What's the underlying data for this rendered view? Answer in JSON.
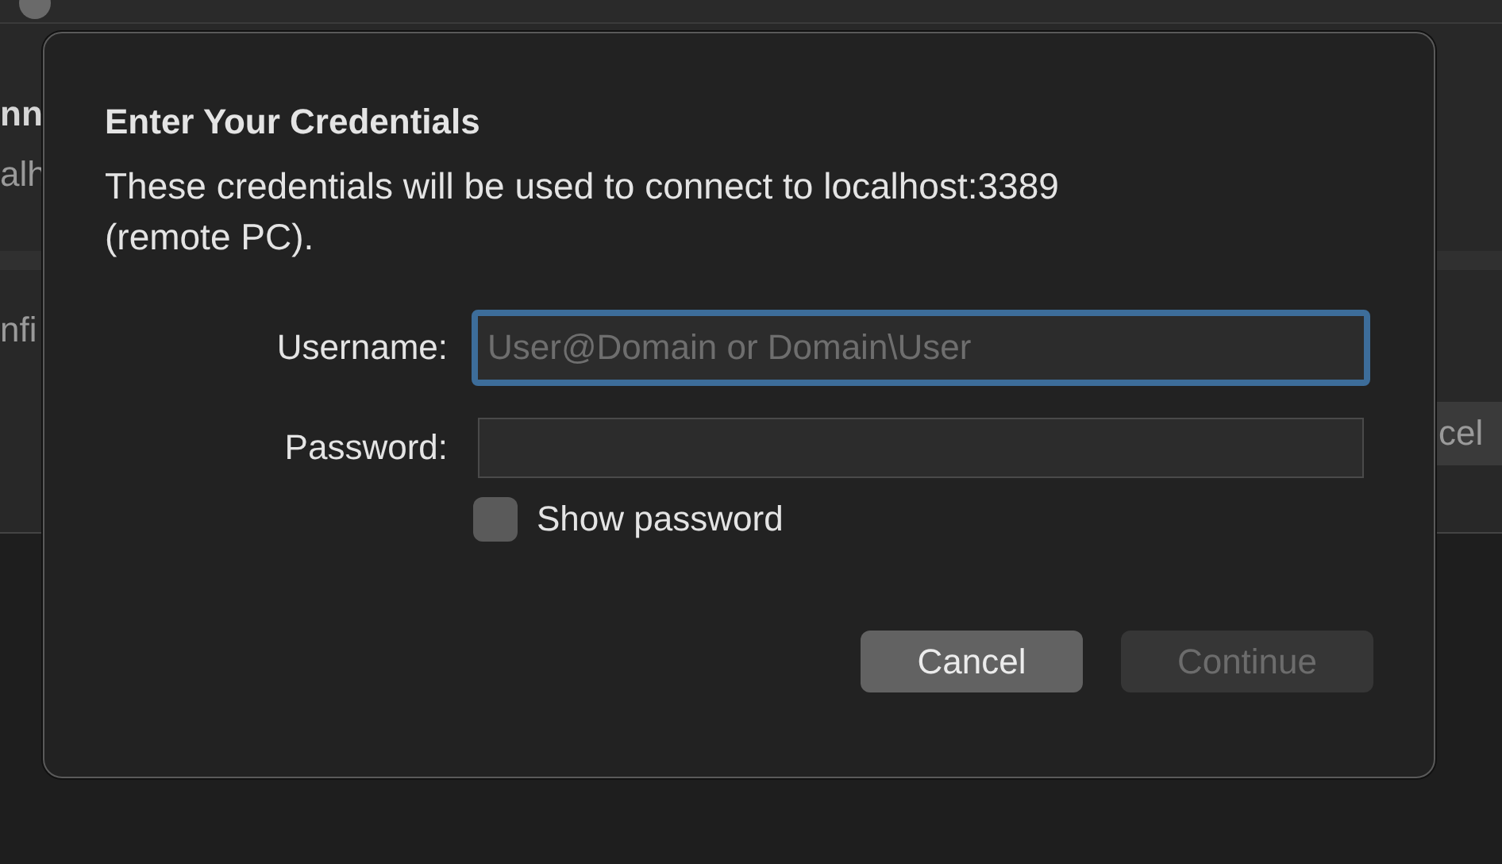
{
  "background_window": {
    "fragments": [
      {
        "kind": "heading",
        "text": "nn"
      },
      {
        "kind": "text",
        "text": "alh"
      },
      {
        "kind": "text",
        "text": "nfi"
      }
    ],
    "button": {
      "label": "cel"
    }
  },
  "dialog": {
    "title": "Enter Your Credentials",
    "message": "These credentials will be used to connect to localhost:3389 (remote PC).",
    "fields": [
      {
        "label": "Username:",
        "placeholder": "User@Domain or Domain\\User",
        "focused": true
      },
      {
        "label": "Password:",
        "focused": false
      }
    ],
    "show_password": {
      "label": "Show password",
      "checked": false
    },
    "buttons": [
      {
        "label": "Cancel",
        "disabled": false
      },
      {
        "label": "Continue",
        "disabled": true
      }
    ]
  }
}
